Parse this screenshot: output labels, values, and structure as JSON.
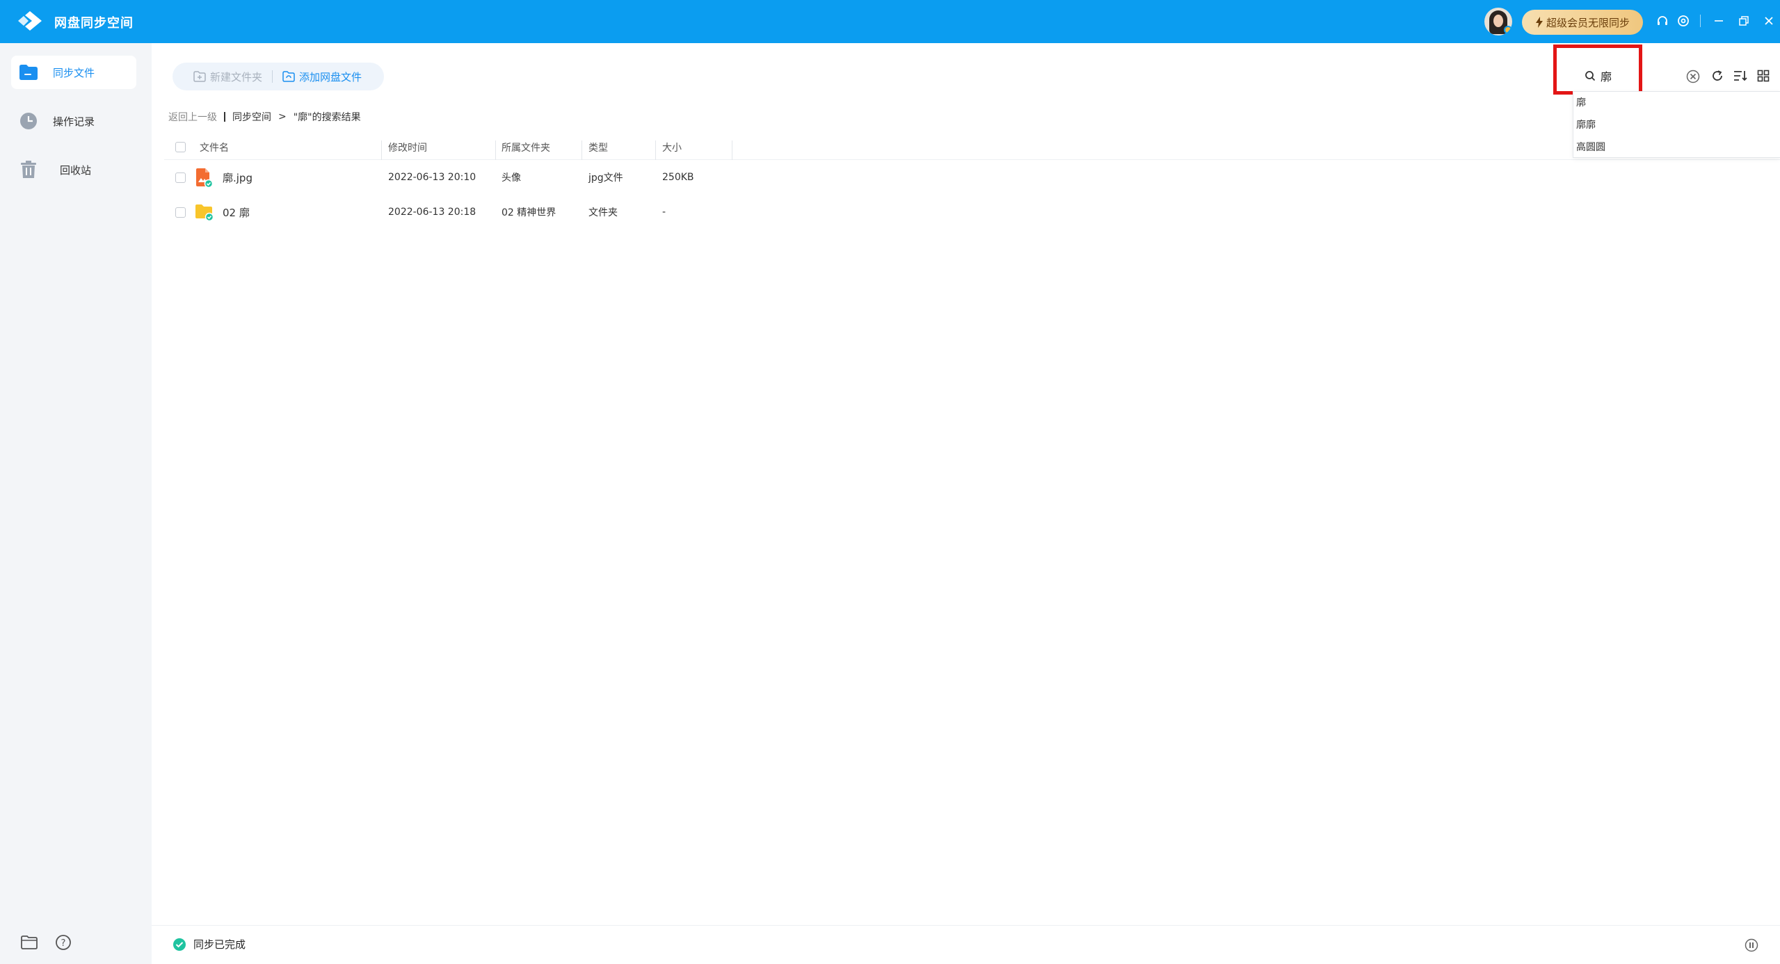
{
  "app": {
    "title": "网盘同步空间",
    "vip_label": "超级会员无限同步",
    "colors": {
      "titlebar": "#0b9df0",
      "accent": "#1a8ff0",
      "highlight": "#e31616"
    }
  },
  "sidebar": {
    "items": [
      {
        "label": "同步文件",
        "icon": "folder-icon",
        "active": true
      },
      {
        "label": "操作记录",
        "icon": "clock-icon",
        "active": false
      },
      {
        "label": "回收站",
        "icon": "trash-icon",
        "active": false
      }
    ],
    "bottom_icons": [
      "open-folder-icon",
      "help-icon"
    ]
  },
  "toolbar": {
    "new_folder": "新建文件夹",
    "add_cloud_file": "添加网盘文件"
  },
  "search": {
    "value": "廓",
    "suggestions": [
      "廓",
      "廓廓",
      "高圆圆"
    ]
  },
  "breadcrumb": {
    "back": "返回上一级",
    "root": "同步空间",
    "arrow": ">",
    "current": "\"廓\"的搜索结果"
  },
  "table": {
    "columns": [
      "文件名",
      "修改时间",
      "所属文件夹",
      "类型",
      "大小"
    ],
    "rows": [
      {
        "name": "廓.jpg",
        "modified": "2022-06-13 20:10",
        "folder": "头像",
        "type": "jpg文件",
        "size": "250KB",
        "icon": "image-file-icon"
      },
      {
        "name": "02 廓",
        "modified": "2022-06-13 20:18",
        "folder": "02 精神世界",
        "type": "文件夹",
        "size": "-",
        "icon": "folder-icon"
      }
    ]
  },
  "status": {
    "text": "同步已完成"
  }
}
